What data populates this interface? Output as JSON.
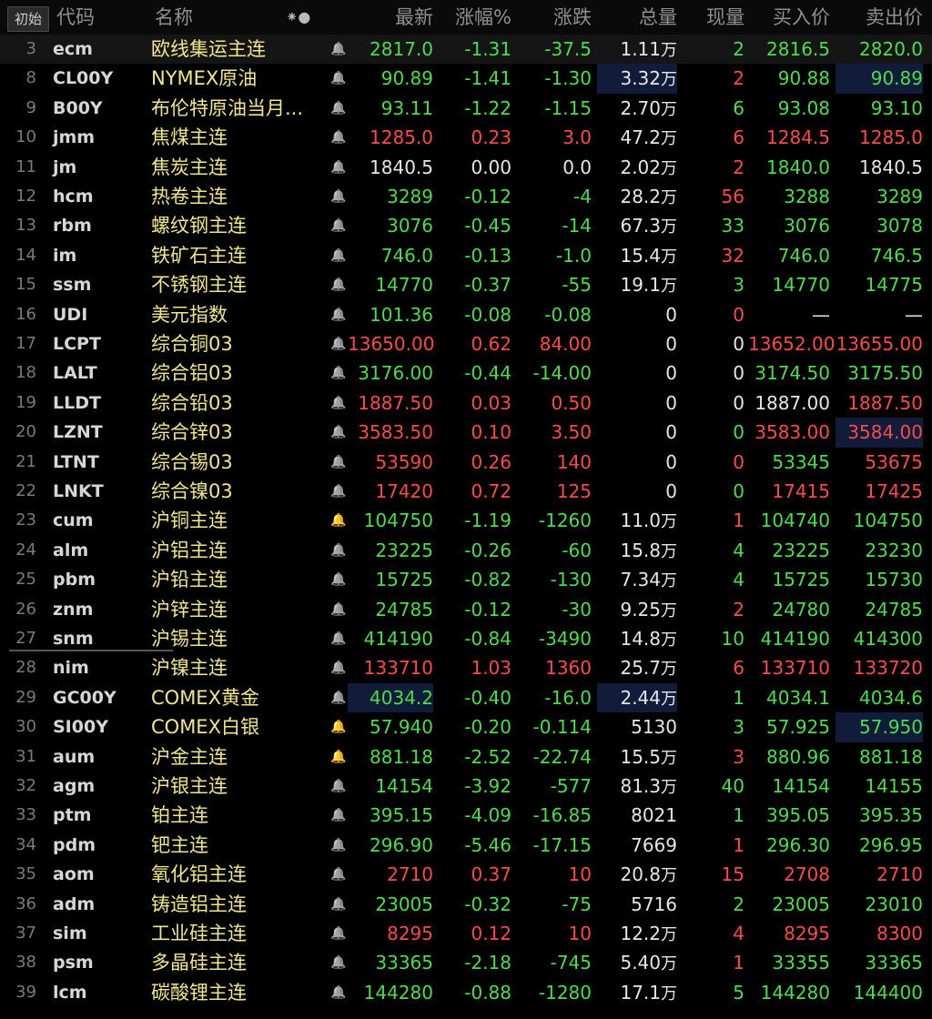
{
  "header": {
    "init_button": "初始",
    "code": "代码",
    "name": "名称",
    "last": "最新",
    "pct": "涨幅%",
    "chg": "涨跌",
    "vol": "总量",
    "cur": "现量",
    "bid": "买入价",
    "ask": "卖出价",
    "settings_glyph": "⁕●"
  },
  "colors": {
    "up": "#ff4a4a",
    "down": "#4ade4a",
    "flat": "#e6e6e6",
    "name": "#f0e68c",
    "alert_bell": "#ff5a1f"
  },
  "rows": [
    {
      "idx": "3",
      "code": "ecm",
      "name": "欧线集运主连",
      "last": "2817.0",
      "pct": "-1.31",
      "chg": "-37.5",
      "vol": "1.11",
      "vol_unit": "万",
      "cur": "2",
      "bid": "2816.5",
      "ask": "2820.0",
      "bell": "normal",
      "cur_dir": "dn",
      "last_dir": "dn",
      "bid_dir": "dn",
      "ask_dir": "dn"
    },
    {
      "idx": "8",
      "code": "CL00Y",
      "name": "NYMEX原油",
      "last": "90.89",
      "pct": "-1.41",
      "chg": "-1.30",
      "vol": "3.32",
      "vol_unit": "万",
      "cur": "2",
      "bid": "90.88",
      "ask": "90.89",
      "bell": "normal",
      "cur_dir": "up",
      "last_dir": "dn",
      "bid_dir": "dn",
      "ask_dir": "dn"
    },
    {
      "idx": "9",
      "code": "B00Y",
      "name": "布伦特原油当月...",
      "last": "93.11",
      "pct": "-1.22",
      "chg": "-1.15",
      "vol": "2.70",
      "vol_unit": "万",
      "cur": "6",
      "bid": "93.08",
      "ask": "93.10",
      "bell": "normal",
      "cur_dir": "dn",
      "last_dir": "dn",
      "bid_dir": "dn",
      "ask_dir": "dn"
    },
    {
      "idx": "10",
      "code": "jmm",
      "name": "焦煤主连",
      "last": "1285.0",
      "pct": "0.23",
      "chg": "3.0",
      "vol": "47.2",
      "vol_unit": "万",
      "cur": "6",
      "bid": "1284.5",
      "ask": "1285.0",
      "bell": "normal",
      "cur_dir": "up",
      "last_dir": "up",
      "bid_dir": "up",
      "ask_dir": "up"
    },
    {
      "idx": "11",
      "code": "jm",
      "name": "焦炭主连",
      "last": "1840.5",
      "pct": "0.00",
      "chg": "0.0",
      "vol": "2.02",
      "vol_unit": "万",
      "cur": "2",
      "bid": "1840.0",
      "ask": "1840.5",
      "bell": "normal",
      "cur_dir": "up",
      "last_dir": "fl",
      "bid_dir": "dn",
      "ask_dir": "fl"
    },
    {
      "idx": "12",
      "code": "hcm",
      "name": "热卷主连",
      "last": "3289",
      "pct": "-0.12",
      "chg": "-4",
      "vol": "28.2",
      "vol_unit": "万",
      "cur": "56",
      "bid": "3288",
      "ask": "3289",
      "bell": "normal",
      "cur_dir": "up",
      "last_dir": "dn",
      "bid_dir": "dn",
      "ask_dir": "dn"
    },
    {
      "idx": "13",
      "code": "rbm",
      "name": "螺纹钢主连",
      "last": "3076",
      "pct": "-0.45",
      "chg": "-14",
      "vol": "67.3",
      "vol_unit": "万",
      "cur": "33",
      "bid": "3076",
      "ask": "3078",
      "bell": "normal",
      "cur_dir": "dn",
      "last_dir": "dn",
      "bid_dir": "dn",
      "ask_dir": "dn"
    },
    {
      "idx": "14",
      "code": "im",
      "name": "铁矿石主连",
      "last": "746.0",
      "pct": "-0.13",
      "chg": "-1.0",
      "vol": "15.4",
      "vol_unit": "万",
      "cur": "32",
      "bid": "746.0",
      "ask": "746.5",
      "bell": "normal",
      "cur_dir": "up",
      "last_dir": "dn",
      "bid_dir": "dn",
      "ask_dir": "dn"
    },
    {
      "idx": "15",
      "code": "ssm",
      "name": "不锈钢主连",
      "last": "14770",
      "pct": "-0.37",
      "chg": "-55",
      "vol": "19.1",
      "vol_unit": "万",
      "cur": "3",
      "bid": "14770",
      "ask": "14775",
      "bell": "normal",
      "cur_dir": "dn",
      "last_dir": "dn",
      "bid_dir": "dn",
      "ask_dir": "dn"
    },
    {
      "idx": "16",
      "code": "UDI",
      "name": "美元指数",
      "last": "101.36",
      "pct": "-0.08",
      "chg": "-0.08",
      "vol": "0",
      "vol_unit": "",
      "cur": "0",
      "bid": "—",
      "ask": "—",
      "bell": "normal",
      "cur_dir": "up",
      "last_dir": "dn",
      "bid_dir": "fl",
      "ask_dir": "fl"
    },
    {
      "idx": "17",
      "code": "LCPT",
      "name": "综合铜03",
      "last": "13650.00",
      "pct": "0.62",
      "chg": "84.00",
      "vol": "0",
      "vol_unit": "",
      "cur": "0",
      "bid": "13652.00",
      "ask": "13655.00",
      "bell": "normal",
      "cur_dir": "fl",
      "last_dir": "up",
      "bid_dir": "up",
      "ask_dir": "up"
    },
    {
      "idx": "18",
      "code": "LALT",
      "name": "综合铝03",
      "last": "3176.00",
      "pct": "-0.44",
      "chg": "-14.00",
      "vol": "0",
      "vol_unit": "",
      "cur": "0",
      "bid": "3174.50",
      "ask": "3175.50",
      "bell": "normal",
      "cur_dir": "fl",
      "last_dir": "dn",
      "bid_dir": "dn",
      "ask_dir": "dn"
    },
    {
      "idx": "19",
      "code": "LLDT",
      "name": "综合铅03",
      "last": "1887.50",
      "pct": "0.03",
      "chg": "0.50",
      "vol": "0",
      "vol_unit": "",
      "cur": "0",
      "bid": "1887.00",
      "ask": "1887.50",
      "bell": "normal",
      "cur_dir": "fl",
      "last_dir": "up",
      "bid_dir": "fl",
      "ask_dir": "up"
    },
    {
      "idx": "20",
      "code": "LZNT",
      "name": "综合锌03",
      "last": "3583.50",
      "pct": "0.10",
      "chg": "3.50",
      "vol": "0",
      "vol_unit": "",
      "cur": "0",
      "bid": "3583.00",
      "ask": "3584.00",
      "bell": "normal",
      "cur_dir": "dn",
      "last_dir": "up",
      "bid_dir": "up",
      "ask_dir": "up"
    },
    {
      "idx": "21",
      "code": "LTNT",
      "name": "综合锡03",
      "last": "53590",
      "pct": "0.26",
      "chg": "140",
      "vol": "0",
      "vol_unit": "",
      "cur": "0",
      "bid": "53345",
      "ask": "53675",
      "bell": "normal",
      "cur_dir": "up",
      "last_dir": "up",
      "bid_dir": "dn",
      "ask_dir": "up"
    },
    {
      "idx": "22",
      "code": "LNKT",
      "name": "综合镍03",
      "last": "17420",
      "pct": "0.72",
      "chg": "125",
      "vol": "0",
      "vol_unit": "",
      "cur": "0",
      "bid": "17415",
      "ask": "17425",
      "bell": "normal",
      "cur_dir": "dn",
      "last_dir": "up",
      "bid_dir": "up",
      "ask_dir": "up"
    },
    {
      "idx": "23",
      "code": "cum",
      "name": "沪铜主连",
      "last": "104750",
      "pct": "-1.19",
      "chg": "-1260",
      "vol": "11.0",
      "vol_unit": "万",
      "cur": "1",
      "bid": "104740",
      "ask": "104750",
      "bell": "alert",
      "cur_dir": "up",
      "last_dir": "dn",
      "bid_dir": "dn",
      "ask_dir": "dn"
    },
    {
      "idx": "24",
      "code": "alm",
      "name": "沪铝主连",
      "last": "23225",
      "pct": "-0.26",
      "chg": "-60",
      "vol": "15.8",
      "vol_unit": "万",
      "cur": "4",
      "bid": "23225",
      "ask": "23230",
      "bell": "normal",
      "cur_dir": "dn",
      "last_dir": "dn",
      "bid_dir": "dn",
      "ask_dir": "dn"
    },
    {
      "idx": "25",
      "code": "pbm",
      "name": "沪铅主连",
      "last": "15725",
      "pct": "-0.82",
      "chg": "-130",
      "vol": "7.34",
      "vol_unit": "万",
      "cur": "4",
      "bid": "15725",
      "ask": "15730",
      "bell": "normal",
      "cur_dir": "dn",
      "last_dir": "dn",
      "bid_dir": "dn",
      "ask_dir": "dn"
    },
    {
      "idx": "26",
      "code": "znm",
      "name": "沪锌主连",
      "last": "24785",
      "pct": "-0.12",
      "chg": "-30",
      "vol": "9.25",
      "vol_unit": "万",
      "cur": "2",
      "bid": "24780",
      "ask": "24785",
      "bell": "normal",
      "cur_dir": "up",
      "last_dir": "dn",
      "bid_dir": "dn",
      "ask_dir": "dn"
    },
    {
      "idx": "27",
      "code": "snm",
      "name": "沪锡主连",
      "last": "414190",
      "pct": "-0.84",
      "chg": "-3490",
      "vol": "14.8",
      "vol_unit": "万",
      "cur": "10",
      "bid": "414190",
      "ask": "414300",
      "bell": "normal",
      "cur_dir": "dn",
      "last_dir": "dn",
      "bid_dir": "dn",
      "ask_dir": "dn"
    },
    {
      "idx": "28",
      "code": "nim",
      "name": "沪镍主连",
      "last": "133710",
      "pct": "1.03",
      "chg": "1360",
      "vol": "25.7",
      "vol_unit": "万",
      "cur": "6",
      "bid": "133710",
      "ask": "133720",
      "bell": "normal",
      "cur_dir": "up",
      "last_dir": "up",
      "bid_dir": "up",
      "ask_dir": "up"
    },
    {
      "idx": "29",
      "code": "GC00Y",
      "name": "COMEX黄金",
      "last": "4034.2",
      "pct": "-0.40",
      "chg": "-16.0",
      "vol": "2.44",
      "vol_unit": "万",
      "cur": "1",
      "bid": "4034.1",
      "ask": "4034.6",
      "bell": "normal",
      "cur_dir": "dn",
      "last_dir": "dn",
      "bid_dir": "dn",
      "ask_dir": "dn"
    },
    {
      "idx": "30",
      "code": "SI00Y",
      "name": "COMEX白银",
      "last": "57.940",
      "pct": "-0.20",
      "chg": "-0.114",
      "vol": "5130",
      "vol_unit": "",
      "cur": "3",
      "bid": "57.925",
      "ask": "57.950",
      "bell": "alert",
      "cur_dir": "dn",
      "last_dir": "dn",
      "bid_dir": "dn",
      "ask_dir": "dn"
    },
    {
      "idx": "31",
      "code": "aum",
      "name": "沪金主连",
      "last": "881.18",
      "pct": "-2.52",
      "chg": "-22.74",
      "vol": "15.5",
      "vol_unit": "万",
      "cur": "3",
      "bid": "880.96",
      "ask": "881.18",
      "bell": "alert",
      "cur_dir": "up",
      "last_dir": "dn",
      "bid_dir": "dn",
      "ask_dir": "dn"
    },
    {
      "idx": "32",
      "code": "agm",
      "name": "沪银主连",
      "last": "14154",
      "pct": "-3.92",
      "chg": "-577",
      "vol": "81.3",
      "vol_unit": "万",
      "cur": "40",
      "bid": "14154",
      "ask": "14155",
      "bell": "normal",
      "cur_dir": "dn",
      "last_dir": "dn",
      "bid_dir": "dn",
      "ask_dir": "dn"
    },
    {
      "idx": "33",
      "code": "ptm",
      "name": "铂主连",
      "last": "395.15",
      "pct": "-4.09",
      "chg": "-16.85",
      "vol": "8021",
      "vol_unit": "",
      "cur": "1",
      "bid": "395.05",
      "ask": "395.35",
      "bell": "normal",
      "cur_dir": "dn",
      "last_dir": "dn",
      "bid_dir": "dn",
      "ask_dir": "dn"
    },
    {
      "idx": "34",
      "code": "pdm",
      "name": "钯主连",
      "last": "296.90",
      "pct": "-5.46",
      "chg": "-17.15",
      "vol": "7669",
      "vol_unit": "",
      "cur": "1",
      "bid": "296.30",
      "ask": "296.95",
      "bell": "normal",
      "cur_dir": "up",
      "last_dir": "dn",
      "bid_dir": "dn",
      "ask_dir": "dn"
    },
    {
      "idx": "35",
      "code": "aom",
      "name": "氧化铝主连",
      "last": "2710",
      "pct": "0.37",
      "chg": "10",
      "vol": "20.8",
      "vol_unit": "万",
      "cur": "15",
      "bid": "2708",
      "ask": "2710",
      "bell": "normal",
      "cur_dir": "up",
      "last_dir": "up",
      "bid_dir": "up",
      "ask_dir": "up"
    },
    {
      "idx": "36",
      "code": "adm",
      "name": "铸造铝主连",
      "last": "23005",
      "pct": "-0.32",
      "chg": "-75",
      "vol": "5716",
      "vol_unit": "",
      "cur": "2",
      "bid": "23005",
      "ask": "23010",
      "bell": "normal",
      "cur_dir": "dn",
      "last_dir": "dn",
      "bid_dir": "dn",
      "ask_dir": "dn"
    },
    {
      "idx": "37",
      "code": "sim",
      "name": "工业硅主连",
      "last": "8295",
      "pct": "0.12",
      "chg": "10",
      "vol": "12.2",
      "vol_unit": "万",
      "cur": "4",
      "bid": "8295",
      "ask": "8300",
      "bell": "normal",
      "cur_dir": "up",
      "last_dir": "up",
      "bid_dir": "up",
      "ask_dir": "up"
    },
    {
      "idx": "38",
      "code": "psm",
      "name": "多晶硅主连",
      "last": "33365",
      "pct": "-2.18",
      "chg": "-745",
      "vol": "5.40",
      "vol_unit": "万",
      "cur": "1",
      "bid": "33355",
      "ask": "33365",
      "bell": "normal",
      "cur_dir": "up",
      "last_dir": "dn",
      "bid_dir": "dn",
      "ask_dir": "dn"
    },
    {
      "idx": "39",
      "code": "lcm",
      "name": "碳酸锂主连",
      "last": "144280",
      "pct": "-0.88",
      "chg": "-1280",
      "vol": "17.1",
      "vol_unit": "万",
      "cur": "5",
      "bid": "144280",
      "ask": "144400",
      "bell": "normal",
      "cur_dir": "dn",
      "last_dir": "dn",
      "bid_dir": "dn",
      "ask_dir": "dn"
    }
  ]
}
